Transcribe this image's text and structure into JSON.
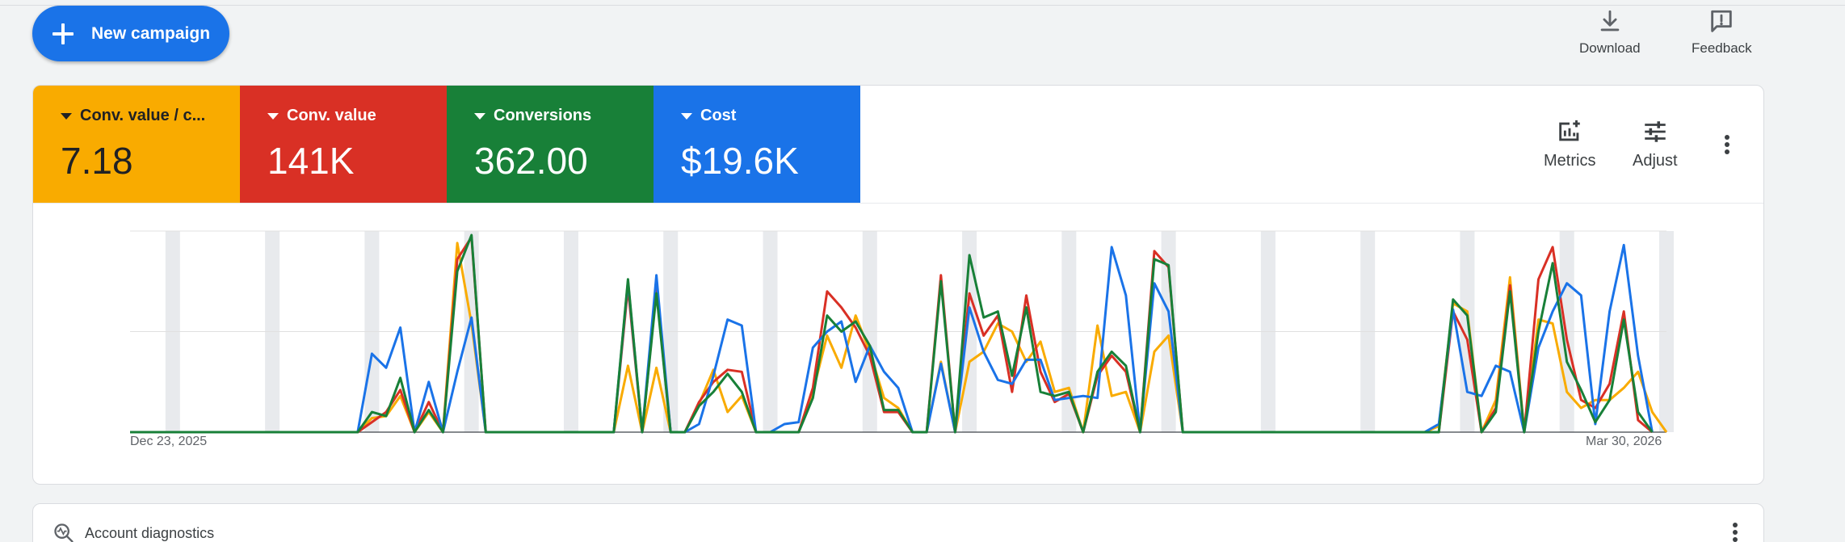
{
  "header": {
    "new_campaign_label": "New campaign",
    "download_label": "Download",
    "feedback_label": "Feedback"
  },
  "metric_tabs": [
    {
      "label": "Conv. value / c...",
      "value": "7.18",
      "color": "#f9ab00"
    },
    {
      "label": "Conv. value",
      "value": "141K",
      "color": "#d93025"
    },
    {
      "label": "Conversions",
      "value": "362.00",
      "color": "#188038"
    },
    {
      "label": "Cost",
      "value": "$19.6K",
      "color": "#1a73e8"
    }
  ],
  "chart_tools": {
    "metrics_label": "Metrics",
    "adjust_label": "Adjust"
  },
  "chart_data": {
    "type": "line",
    "x_start": "Dec 23, 2025",
    "x_end": "Mar 30, 2026",
    "grid": true,
    "weekend_bands": true,
    "series": [
      {
        "color": "#f9ab00",
        "values": [
          0,
          0,
          0,
          0,
          0,
          0,
          0,
          0,
          0,
          0,
          0,
          0,
          0,
          0,
          0,
          0,
          0,
          7,
          8,
          18,
          0,
          10,
          0,
          94,
          54,
          0,
          0,
          0,
          0,
          0,
          0,
          0,
          0,
          0,
          0,
          33,
          0,
          32,
          0,
          0,
          14,
          31,
          10,
          18,
          0,
          0,
          0,
          0,
          20,
          48,
          32,
          58,
          40,
          17,
          12,
          0,
          0,
          35,
          0,
          35,
          40,
          54,
          50,
          35,
          45,
          20,
          22,
          0,
          53,
          18,
          20,
          0,
          40,
          48,
          0,
          0,
          0,
          0,
          0,
          0,
          0,
          0,
          0,
          0,
          0,
          0,
          0,
          0,
          0,
          0,
          0,
          0,
          3,
          64,
          60,
          0,
          16,
          77,
          0,
          56,
          54,
          20,
          12,
          16,
          16,
          22,
          30,
          10,
          0
        ]
      },
      {
        "color": "#d93025",
        "values": [
          0,
          0,
          0,
          0,
          0,
          0,
          0,
          0,
          0,
          0,
          0,
          0,
          0,
          0,
          0,
          0,
          0,
          5,
          10,
          21,
          0,
          15,
          0,
          86,
          97,
          0,
          0,
          0,
          0,
          0,
          0,
          0,
          0,
          0,
          0,
          72,
          0,
          71,
          0,
          0,
          15,
          25,
          31,
          30,
          0,
          0,
          0,
          0,
          22,
          70,
          62,
          52,
          38,
          10,
          10,
          0,
          0,
          78,
          0,
          69,
          48,
          58,
          20,
          68,
          30,
          15,
          19,
          0,
          28,
          38,
          30,
          0,
          90,
          82,
          0,
          0,
          0,
          0,
          0,
          0,
          0,
          0,
          0,
          0,
          0,
          0,
          0,
          0,
          0,
          0,
          0,
          0,
          0,
          60,
          46,
          0,
          12,
          73,
          0,
          76,
          92,
          46,
          16,
          12,
          24,
          60,
          6,
          0
        ]
      },
      {
        "color": "#1a73e8",
        "values": [
          0,
          0,
          0,
          0,
          0,
          0,
          0,
          0,
          0,
          0,
          0,
          0,
          0,
          0,
          0,
          0,
          0,
          39,
          32,
          52,
          0,
          25,
          0,
          30,
          57,
          0,
          0,
          0,
          0,
          0,
          0,
          0,
          0,
          0,
          0,
          75,
          0,
          78,
          0,
          0,
          4,
          28,
          56,
          53,
          0,
          0,
          4,
          5,
          42,
          50,
          55,
          25,
          43,
          30,
          22,
          0,
          0,
          34,
          0,
          62,
          40,
          26,
          24,
          36,
          36,
          16,
          17,
          18,
          17,
          92,
          68,
          0,
          74,
          60,
          0,
          0,
          0,
          0,
          0,
          0,
          0,
          0,
          0,
          0,
          0,
          0,
          0,
          0,
          0,
          0,
          0,
          0,
          4,
          61,
          20,
          18,
          33,
          30,
          0,
          42,
          60,
          74,
          68,
          4,
          60,
          93,
          38,
          0
        ]
      },
      {
        "color": "#188038",
        "values": [
          0,
          0,
          0,
          0,
          0,
          0,
          0,
          0,
          0,
          0,
          0,
          0,
          0,
          0,
          0,
          0,
          0,
          10,
          8,
          27,
          0,
          11,
          0,
          80,
          98,
          0,
          0,
          0,
          0,
          0,
          0,
          0,
          0,
          0,
          0,
          76,
          0,
          69,
          0,
          0,
          13,
          20,
          29,
          20,
          0,
          0,
          0,
          0,
          17,
          58,
          50,
          55,
          43,
          11,
          11,
          0,
          0,
          75,
          0,
          88,
          57,
          60,
          28,
          62,
          20,
          18,
          20,
          0,
          30,
          40,
          33,
          0,
          86,
          83,
          0,
          0,
          0,
          0,
          0,
          0,
          0,
          0,
          0,
          0,
          0,
          0,
          0,
          0,
          0,
          0,
          0,
          0,
          0,
          66,
          58,
          0,
          10,
          70,
          0,
          50,
          84,
          35,
          21,
          5,
          16,
          56,
          10,
          0
        ]
      }
    ]
  },
  "diagnostics": {
    "title": "Account diagnostics"
  }
}
